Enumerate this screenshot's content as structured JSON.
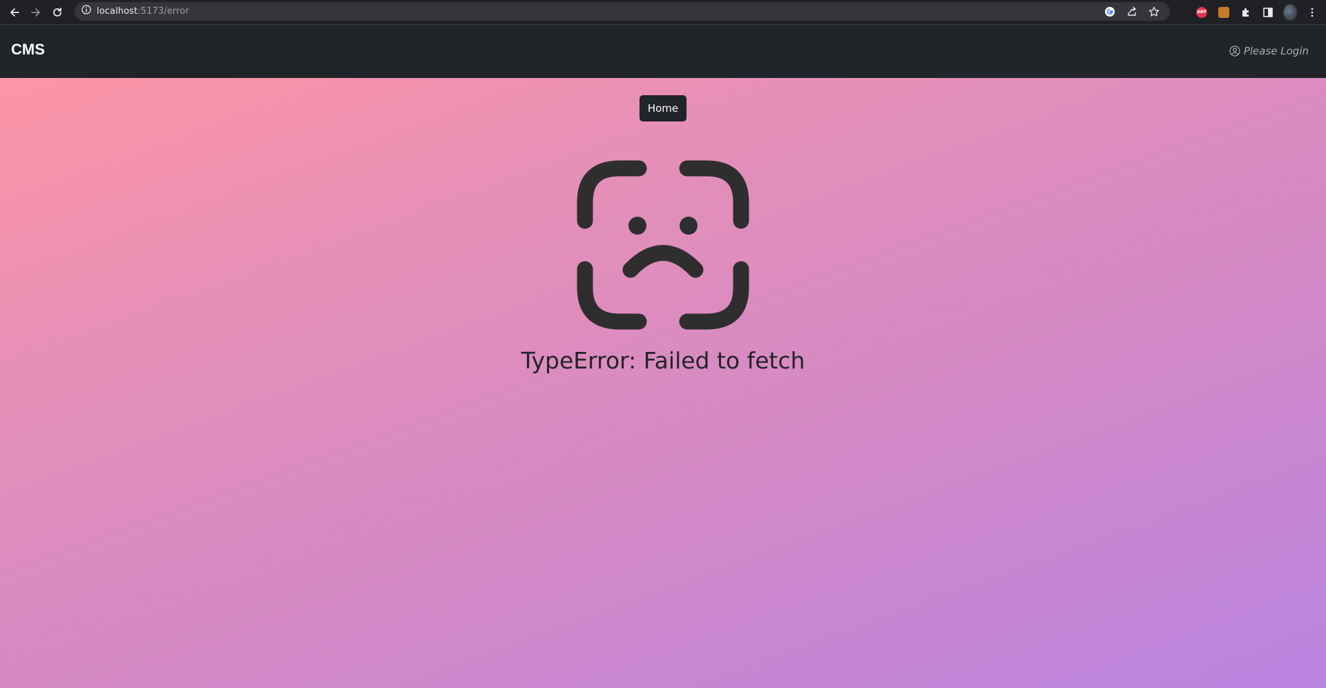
{
  "browser": {
    "url_host": "localhost",
    "url_path": ":5173/error",
    "icons": [
      "back-icon",
      "forward-icon",
      "reload-icon",
      "site-info-icon",
      "google-icon",
      "share-icon",
      "star-icon",
      "adblock-icon",
      "extension-icon",
      "puzzle-icon",
      "side-panel-icon",
      "avatar",
      "menu-icon"
    ],
    "abp_label": "ABP"
  },
  "navbar": {
    "brand": "CMS",
    "login_label": "Please Login",
    "login_icon": "user-circle-icon"
  },
  "main": {
    "home_label": "Home",
    "error_icon": "sad-face-icon",
    "error_message": "TypeError: Failed to fetch"
  },
  "colors": {
    "navbar_bg": "#212529",
    "browser_bg": "#202124",
    "gradient_start": "#fd95a6",
    "gradient_end": "#b984e0",
    "icon_color": "#2e2e2e"
  }
}
